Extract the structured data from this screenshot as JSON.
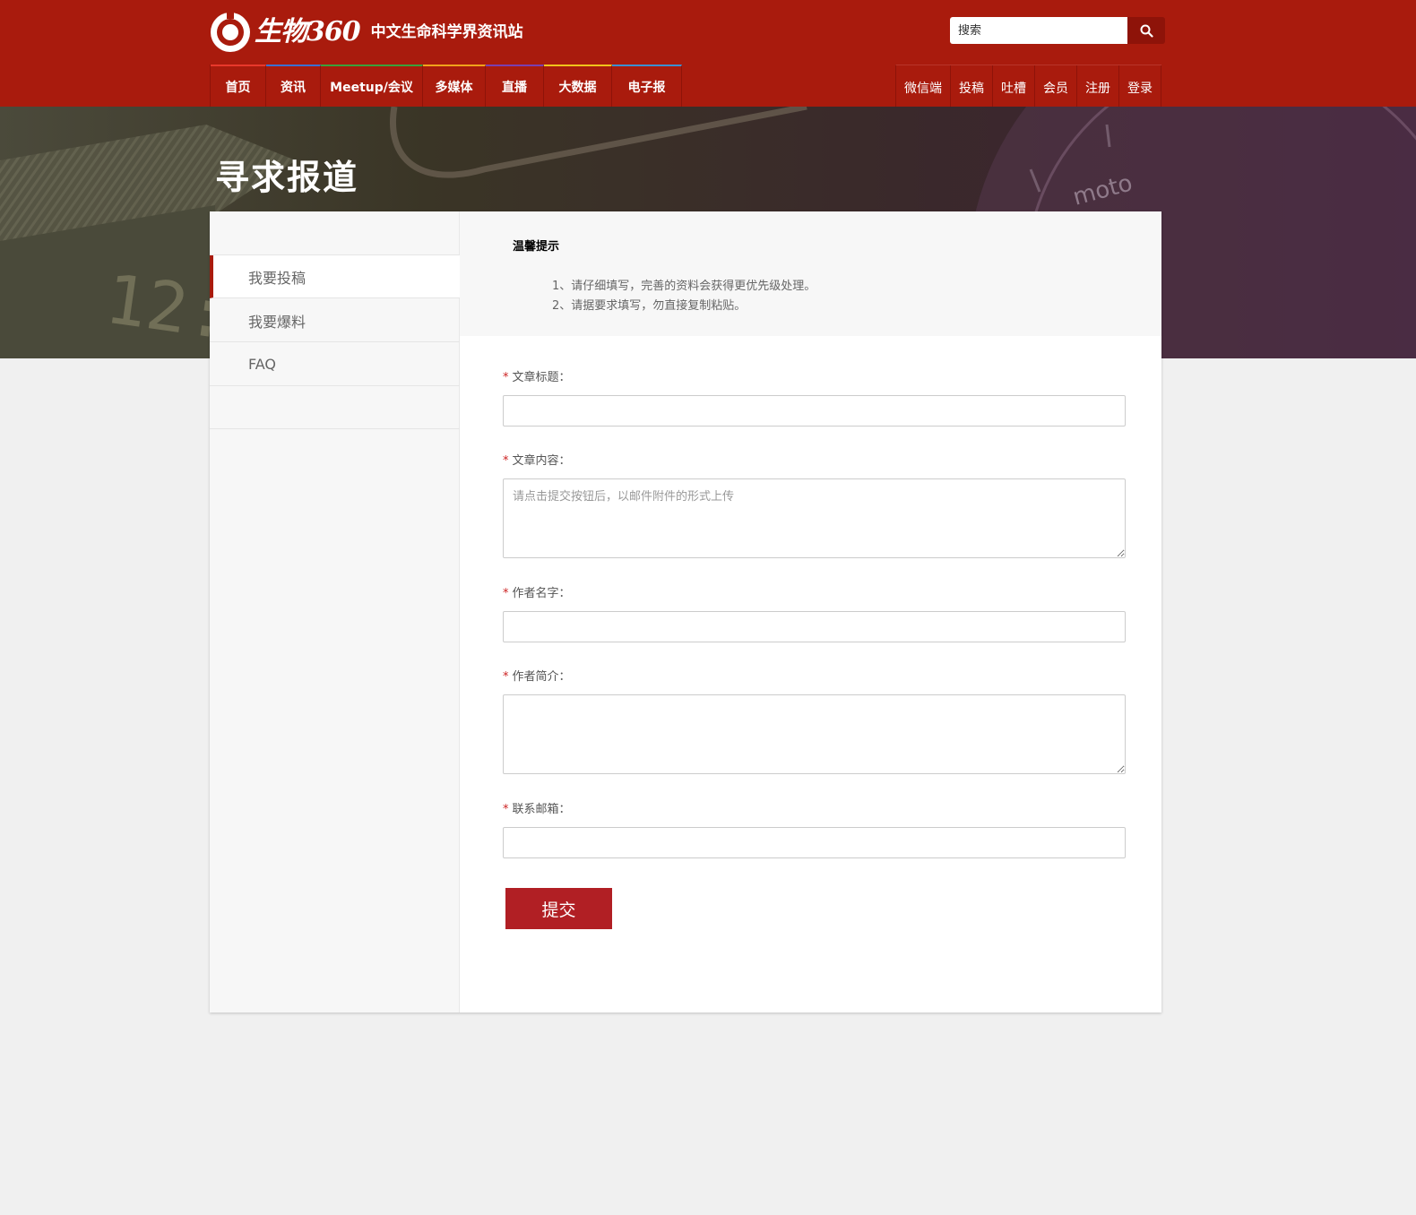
{
  "site": {
    "logo_text": "生物360",
    "tagline": "中文生命科学界资讯站"
  },
  "search": {
    "placeholder": "搜索"
  },
  "nav_left": [
    {
      "label": "首页",
      "accent": "#e8382b"
    },
    {
      "label": "资讯",
      "accent": "#3b6fd1"
    },
    {
      "label": "Meetup/会议",
      "accent": "#3aa13a"
    },
    {
      "label": "多媒体",
      "accent": "#f0a21b"
    },
    {
      "label": "直播",
      "accent": "#7a3fb0"
    },
    {
      "label": "大数据",
      "accent": "#f0c21b"
    },
    {
      "label": "电子报",
      "accent": "#3b8fd1"
    }
  ],
  "nav_right": [
    "微信端",
    "投稿",
    "吐槽",
    "会员",
    "注册",
    "登录"
  ],
  "banner": {
    "title": "寻求报道"
  },
  "sidebar": {
    "items": [
      {
        "label": "我要投稿",
        "active": true
      },
      {
        "label": "我要爆料",
        "active": false
      },
      {
        "label": "FAQ",
        "active": false
      }
    ]
  },
  "notice": {
    "title": "温馨提示",
    "lines": [
      "1、请仔细填写，完善的资料会获得更优先级处理。",
      "2、请据要求填写，勿直接复制粘贴。"
    ]
  },
  "form": {
    "required_mark": "*",
    "title_label": "文章标题：",
    "content_label": "文章内容：",
    "content_placeholder": "请点击提交按钮后，以邮件附件的形式上传",
    "author_label": "作者名字：",
    "bio_label": "作者简介：",
    "email_label": "联系邮箱：",
    "submit_label": "提交"
  },
  "colors": {
    "header_bg": "#a91b0d",
    "accent_red": "#b11f24",
    "page_bg": "#f0f0f0"
  }
}
